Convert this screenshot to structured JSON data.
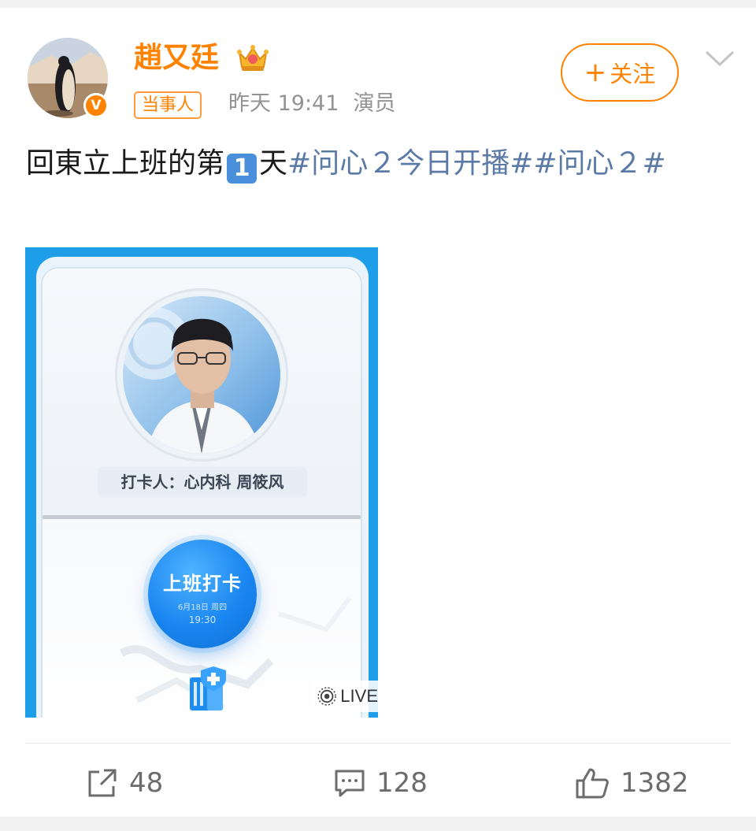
{
  "post": {
    "author": {
      "name": "趙又廷",
      "role_tag": "当事人",
      "verified_mark": "V"
    },
    "meta": {
      "time": "昨天 19:41",
      "occupation": "演员"
    },
    "follow_label": "关注",
    "follow_prefix": "+",
    "text": {
      "prefix": "回東立上班的第",
      "keycap": "1",
      "mid": "天",
      "hashtags": "#问心２今日开播##问心２#"
    },
    "image": {
      "checkin_person": "打卡人：心内科 周筱风",
      "punch_title": "上班打卡",
      "punch_date": "6月18日 周四",
      "punch_time": "19:30",
      "live_badge": "LIVE"
    },
    "actions": {
      "repost_count": "48",
      "comment_count": "128",
      "like_count": "1382"
    }
  },
  "colors": {
    "brand_orange": "#ff8200",
    "hashtag_blue": "#5b7ba6",
    "meta_gray": "#939393",
    "image_blue": "#1e9ee8"
  },
  "icons": [
    "crown-icon",
    "chevron-down-icon",
    "repost-icon",
    "comment-icon",
    "like-icon",
    "live-icon",
    "hospital-building-icon"
  ]
}
